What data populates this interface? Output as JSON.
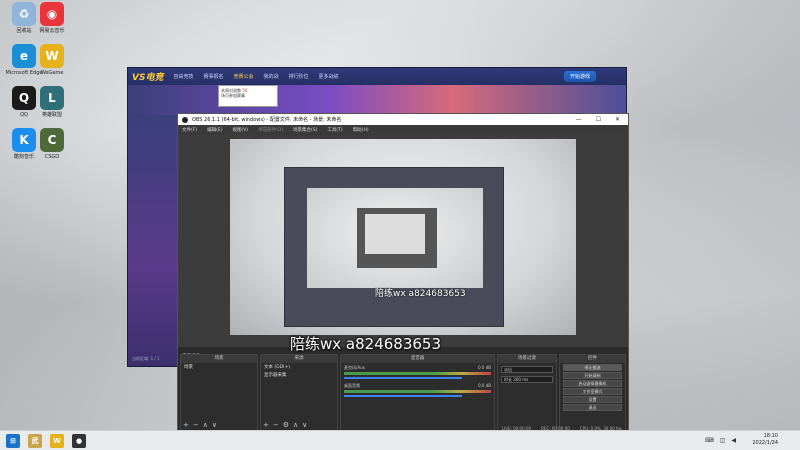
{
  "desktop": {
    "icons": [
      {
        "label": "回收站",
        "glyph": "♻",
        "color": "#8fb6d9"
      },
      {
        "label": "网易云音乐",
        "glyph": "◉",
        "color": "#e8343a"
      },
      {
        "label": "Microsoft Edge",
        "glyph": "e",
        "color": "#1b8fd6"
      },
      {
        "label": "WeGame",
        "glyph": "W",
        "color": "#e5b21c"
      },
      {
        "label": "QQ",
        "glyph": "Q",
        "color": "#1a1a1a"
      },
      {
        "label": "英雄联盟",
        "glyph": "L",
        "color": "#2f6f7a"
      },
      {
        "label": "酷狗音乐",
        "glyph": "K",
        "color": "#1a8ff0"
      },
      {
        "label": "CSGO",
        "glyph": "C",
        "color": "#4f6a3a"
      }
    ]
  },
  "game_client": {
    "logo": "VS电竞",
    "tabs": [
      "自由竞技",
      "赛事报名",
      "竞赛公会",
      "我的战",
      "排行阶位",
      "更多战绩"
    ],
    "active_tab": "竞赛公会",
    "start_button": "开始游戏",
    "tooltip_line1": "本周对战数",
    "tooltip_highlight": "50",
    "tooltip_line2": "场可参加赛事",
    "status": "当前区域: 1 / 1"
  },
  "obs": {
    "title": "OBS 26.1.1 (64-bit, windows) - 配置文件: 未命名 - 场景: 未命名",
    "menu": [
      "文件(F)",
      "编辑(E)",
      "视图(V)",
      "停靠部件(D)",
      "场景集合(S)",
      "工具(T)",
      "帮助(H)"
    ],
    "window_controls": [
      "—",
      "☐",
      "✕"
    ],
    "source_bar_label": "未选择源",
    "inner_watermark": "陪练wx  a824683653",
    "docks": {
      "scenes": {
        "header": "场景",
        "items": [
          "场景"
        ]
      },
      "sources": {
        "header": "来源",
        "items": [
          "文本 (GDI+)",
          "显示器采集"
        ]
      },
      "mixer": {
        "header": "混音器",
        "rows": [
          {
            "label": "麦克风/Aux",
            "db": "0.0 dB"
          },
          {
            "label": "桌面音频",
            "db": "0.0 dB"
          }
        ]
      },
      "transitions": {
        "header": "场景过渡",
        "type": "淡出",
        "duration_label": "时长",
        "duration": "300 ms"
      },
      "controls": {
        "header": "控件",
        "buttons": [
          "停止推流",
          "开始录制",
          "启动虚拟摄像机",
          "工作室模式",
          "设置",
          "退出"
        ]
      }
    },
    "status": {
      "live": "LIVE: 00:00:00",
      "rec": "REC: 00:00:00",
      "cpu": "CPU: 0.9%, 30.00 fps"
    }
  },
  "overlay_watermark": "陪练wx  a824683653",
  "taskbar": {
    "apps": [
      {
        "name": "start",
        "glyph": "⊞",
        "color": "#1a73c9"
      },
      {
        "name": "game",
        "glyph": "武",
        "color": "#c8a44a"
      },
      {
        "name": "wegame",
        "glyph": "W",
        "color": "#e5b21c"
      },
      {
        "name": "obs",
        "glyph": "●",
        "color": "#333333"
      }
    ],
    "time": "18:10",
    "date": "2022/1/24"
  }
}
